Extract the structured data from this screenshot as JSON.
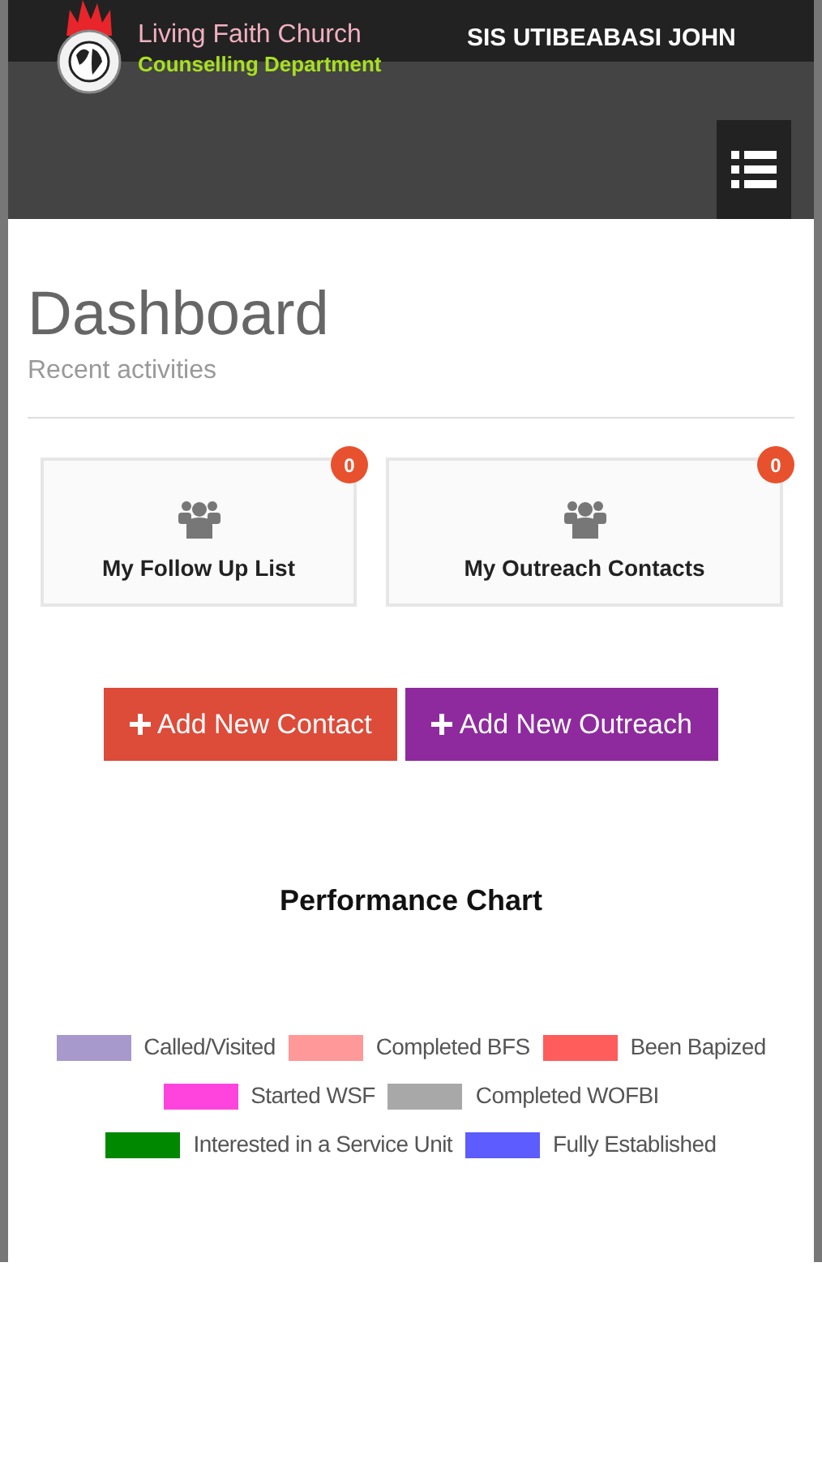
{
  "header": {
    "church_name": "Living Faith Church",
    "department": "Counselling Department",
    "user_name": "SIS UTIBEABASI JOHN"
  },
  "page": {
    "title": "Dashboard",
    "subtitle": "Recent activities"
  },
  "cards": [
    {
      "label": "My Follow Up List",
      "count": "0"
    },
    {
      "label": "My Outreach Contacts",
      "count": "0"
    }
  ],
  "actions": [
    {
      "label": "Add New Contact",
      "color": "#dd4b39"
    },
    {
      "label": "Add New Outreach",
      "color": "#8e2a9e"
    }
  ],
  "chart": {
    "title": "Performance Chart",
    "legend": [
      {
        "label": "Called/Visited",
        "color": "#a899cc"
      },
      {
        "label": "Completed BFS",
        "color": "#ff9999"
      },
      {
        "label": "Been Bapized",
        "color": "#ff5c5c"
      },
      {
        "label": "Started WSF",
        "color": "#ff44dd"
      },
      {
        "label": "Completed WOFBI",
        "color": "#a8a8a8"
      },
      {
        "label": "Interested in a Service Unit",
        "color": "#008800"
      },
      {
        "label": "Fully Established",
        "color": "#5c5cff"
      }
    ]
  }
}
